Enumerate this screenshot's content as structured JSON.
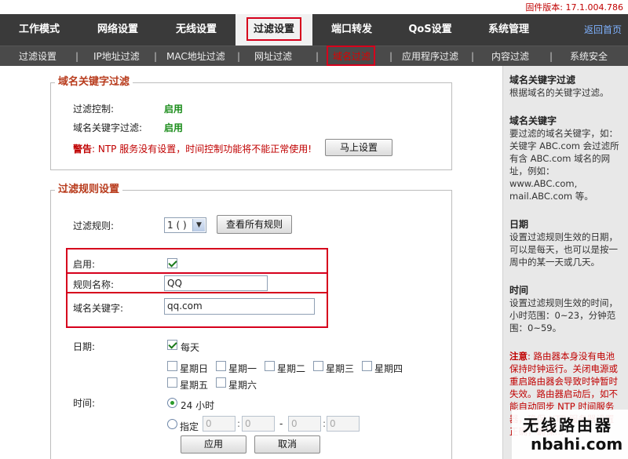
{
  "firmware": "固件版本: 17.1.004.786",
  "top_nav": [
    "工作模式",
    "网络设置",
    "无线设置",
    "过滤设置",
    "端口转发",
    "QoS设置",
    "系统管理"
  ],
  "home_link": "返回首页",
  "sub_nav": [
    "过滤设置",
    "IP地址过滤",
    "MAC地址过滤",
    "网址过滤",
    "域名过滤",
    "应用程序过滤",
    "内容过滤",
    "系统安全"
  ],
  "sub_sep": "|",
  "kw_section": {
    "title": "域名关键字过滤",
    "control_label": "过滤控制:",
    "control_value": "启用",
    "kwfilter_label": "域名关键字过滤:",
    "kwfilter_value": "启用",
    "warn_prefix": "警告",
    "warn_text": ": NTP 服务没有设置，时间控制功能将不能正常使用!",
    "setup_button": "马上设置"
  },
  "rule_section": {
    "title": "过滤规则设置",
    "rule_label": "过滤规则:",
    "rule_selected": "1 ( )",
    "view_all_button": "查看所有规则",
    "enable_label": "启用:",
    "enable_checked": true,
    "name_label": "规则名称:",
    "name_value": "QQ",
    "keyword_label": "域名关键字:",
    "keyword_value": "qq.com",
    "date_label": "日期:",
    "everyday_label": "每天",
    "everyday_checked": true,
    "days": [
      "星期日",
      "星期一",
      "星期二",
      "星期三",
      "星期四",
      "星期五",
      "星期六"
    ],
    "time_label": "时间:",
    "time_24h_label": "24 小时",
    "time_24h_selected": true,
    "time_custom_label": "指定",
    "time_start_h": "0",
    "time_start_m": "0",
    "time_end_h": "0",
    "time_end_m": "0",
    "time_dash": "-",
    "time_colon": ":",
    "apply_button": "应用",
    "cancel_button": "取消"
  },
  "help": {
    "h1": "域名关键字过滤",
    "p1": "根据域名的关键字过滤。",
    "h2": "域名关键字",
    "p2": "要过滤的域名关键字，如：关键字 ABC.com 会过滤所有含 ABC.com 域名的网址，例如：www.ABC.com, mail.ABC.com 等。",
    "h3": "日期",
    "p3": "设置过滤规则生效的日期，可以是每天，也可以是按一周中的某一天或几天。",
    "h4": "时间",
    "p4": "设置过滤规则生效的时间，小时范围：0~23，分钟范围：0~59。",
    "note_prefix": "注意",
    "note_text": ": 路由器本身没有电池保持时钟运行。关闭电源或重启路由器会导致时钟暂时失效。路由器启动后，如不能自动同步 NTP 时间服务器，确保 NTP 服务器设置正确，确保…"
  },
  "watermark": {
    "line1": "无线路由器",
    "line2": "nbahi.com"
  }
}
